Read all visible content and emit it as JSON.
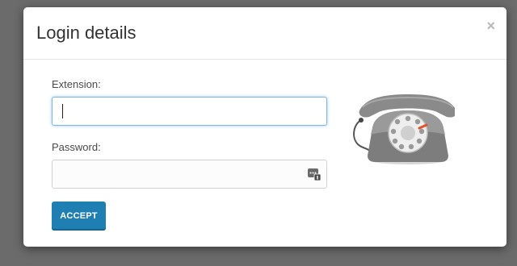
{
  "dialog": {
    "title": "Login details",
    "close_glyph": "×"
  },
  "form": {
    "extension_label": "Extension:",
    "extension_value": "",
    "password_label": "Password:",
    "password_value": "",
    "accept_label": "ACCEPT"
  },
  "icons": {
    "close": "close-icon",
    "password_manager": "password-key-icon",
    "illustration": "rotary-telephone-icon"
  },
  "colors": {
    "overlay": "#6b6b6b",
    "accent": "#1f7fb3",
    "focus_border": "#7fb5e6"
  }
}
